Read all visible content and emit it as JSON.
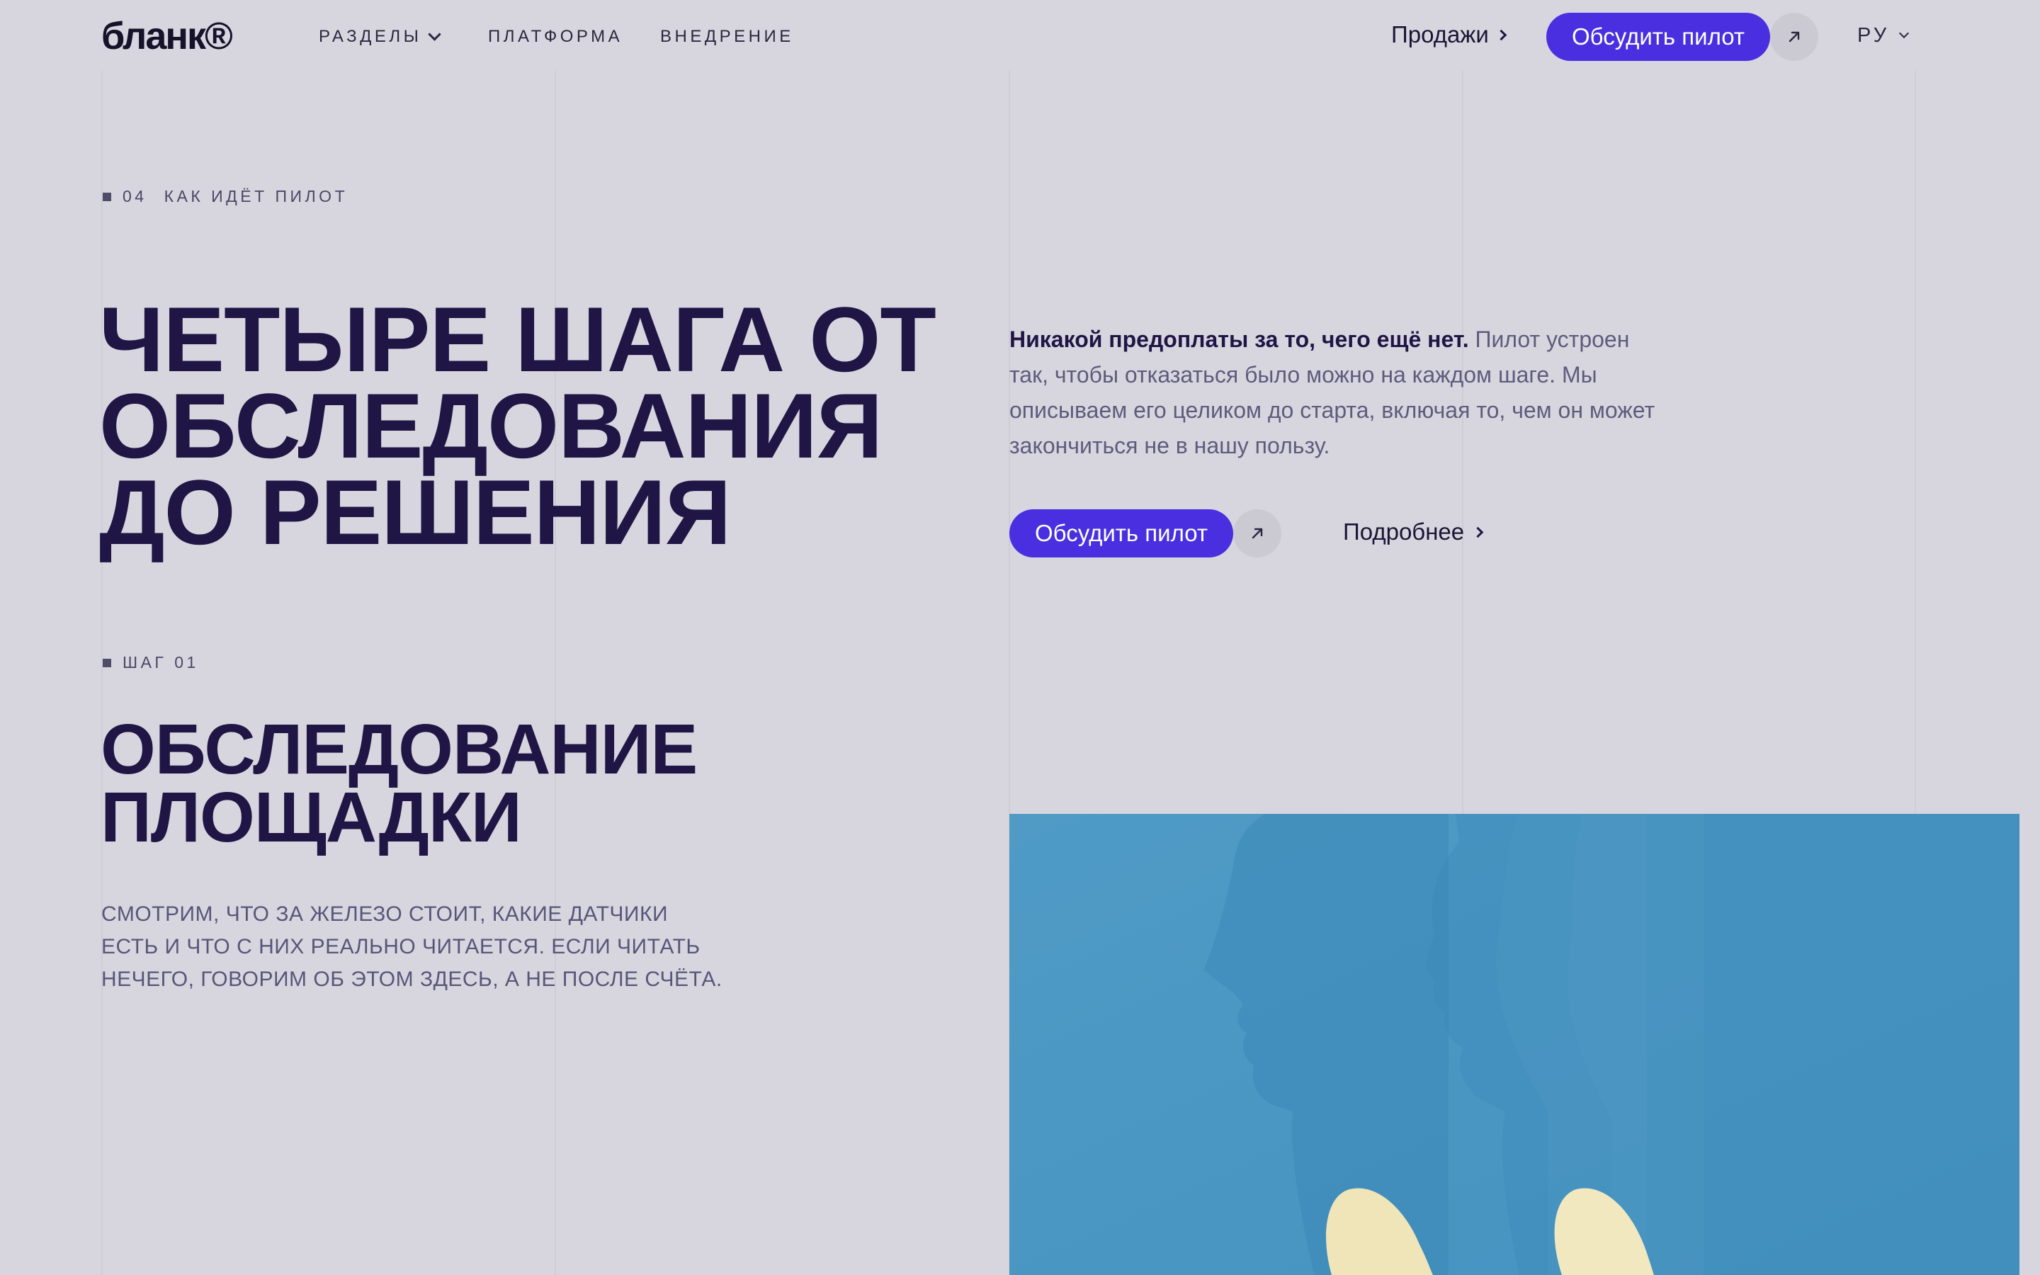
{
  "header": {
    "logo": "бланк®",
    "nav": [
      {
        "label": "РАЗДЕЛЫ",
        "has_dropdown": true
      },
      {
        "label": "ПЛАТФОРМА"
      },
      {
        "label": "ВНЕДРЕНИЕ"
      }
    ],
    "sales_label": "Продажи",
    "cta_label": "Обсудить пилот",
    "lang_label": "РУ"
  },
  "section": {
    "number": "04",
    "label": "КАК ИДЁТ ПИЛОТ",
    "title": "ЧЕТЫРЕ ШАГА ОТ ОБСЛЕДОВАНИЯ ДО РЕШЕНИЯ",
    "intro_bold": "Никакой предоплаты за то, чего ещё нет.",
    "intro_text": " Пилот устроен так, чтобы отказаться было можно на каждом шаге. Мы описываем его целиком до старта, включая то, чем он может закончиться не в нашу пользу.",
    "cta_label": "Обсудить пилот",
    "more_label": "Подробнее"
  },
  "step": {
    "label": "ШАГ 01",
    "title": "ОБСЛЕДОВАНИЕ ПЛОЩАДКИ",
    "body": "СМОТРИМ, ЧТО ЗА ЖЕЛЕЗО СТОИТ, КАКИЕ ДАТЧИКИ ЕСТЬ И ЧТО С НИХ РЕАЛЬНО ЧИТАЕТСЯ. ЕСЛИ ЧИТАТЬ НЕЧЕГО, ГОВОРИМ ОБ ЭТОМ ЗДЕСЬ, А НЕ ПОСЛЕ СЧЁТА."
  },
  "colors": {
    "background": "#d7d6de",
    "accent": "#4a2fe0",
    "heading": "#1f1646",
    "photo_blue": "#4a97c3"
  },
  "icons": {
    "arrow": "arrow-up-right-icon",
    "chevron_down": "chevron-down-icon",
    "chevron_right": "chevron-right-icon"
  }
}
